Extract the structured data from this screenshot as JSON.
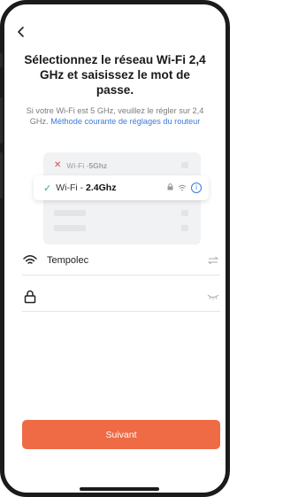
{
  "page": {
    "title": "Sélectionnez le réseau Wi-Fi 2,4 GHz et saisissez le mot de passe.",
    "hint_text": "Si votre Wi-Fi est 5 GHz, veuillez le régler sur 2,4 GHz.",
    "hint_link": "Méthode courante de réglages du routeur"
  },
  "illustration": {
    "band5_prefix": "Wi-Fi - ",
    "band5_name": "5Ghz",
    "band24_prefix": "Wi-Fi - ",
    "band24_name": "2.4Ghz"
  },
  "form": {
    "ssid_value": "Tempolec",
    "password_value": "",
    "password_placeholder": ""
  },
  "actions": {
    "next_label": "Suivant"
  },
  "colors": {
    "accent": "#ee6b45",
    "link": "#3b7bd6",
    "check": "#28b463",
    "error": "#e5484d"
  },
  "icons": [
    "back-icon",
    "wifi-icon",
    "lock-icon",
    "swap-icon",
    "eye-closed-icon",
    "info-icon",
    "check-icon",
    "close-icon"
  ]
}
